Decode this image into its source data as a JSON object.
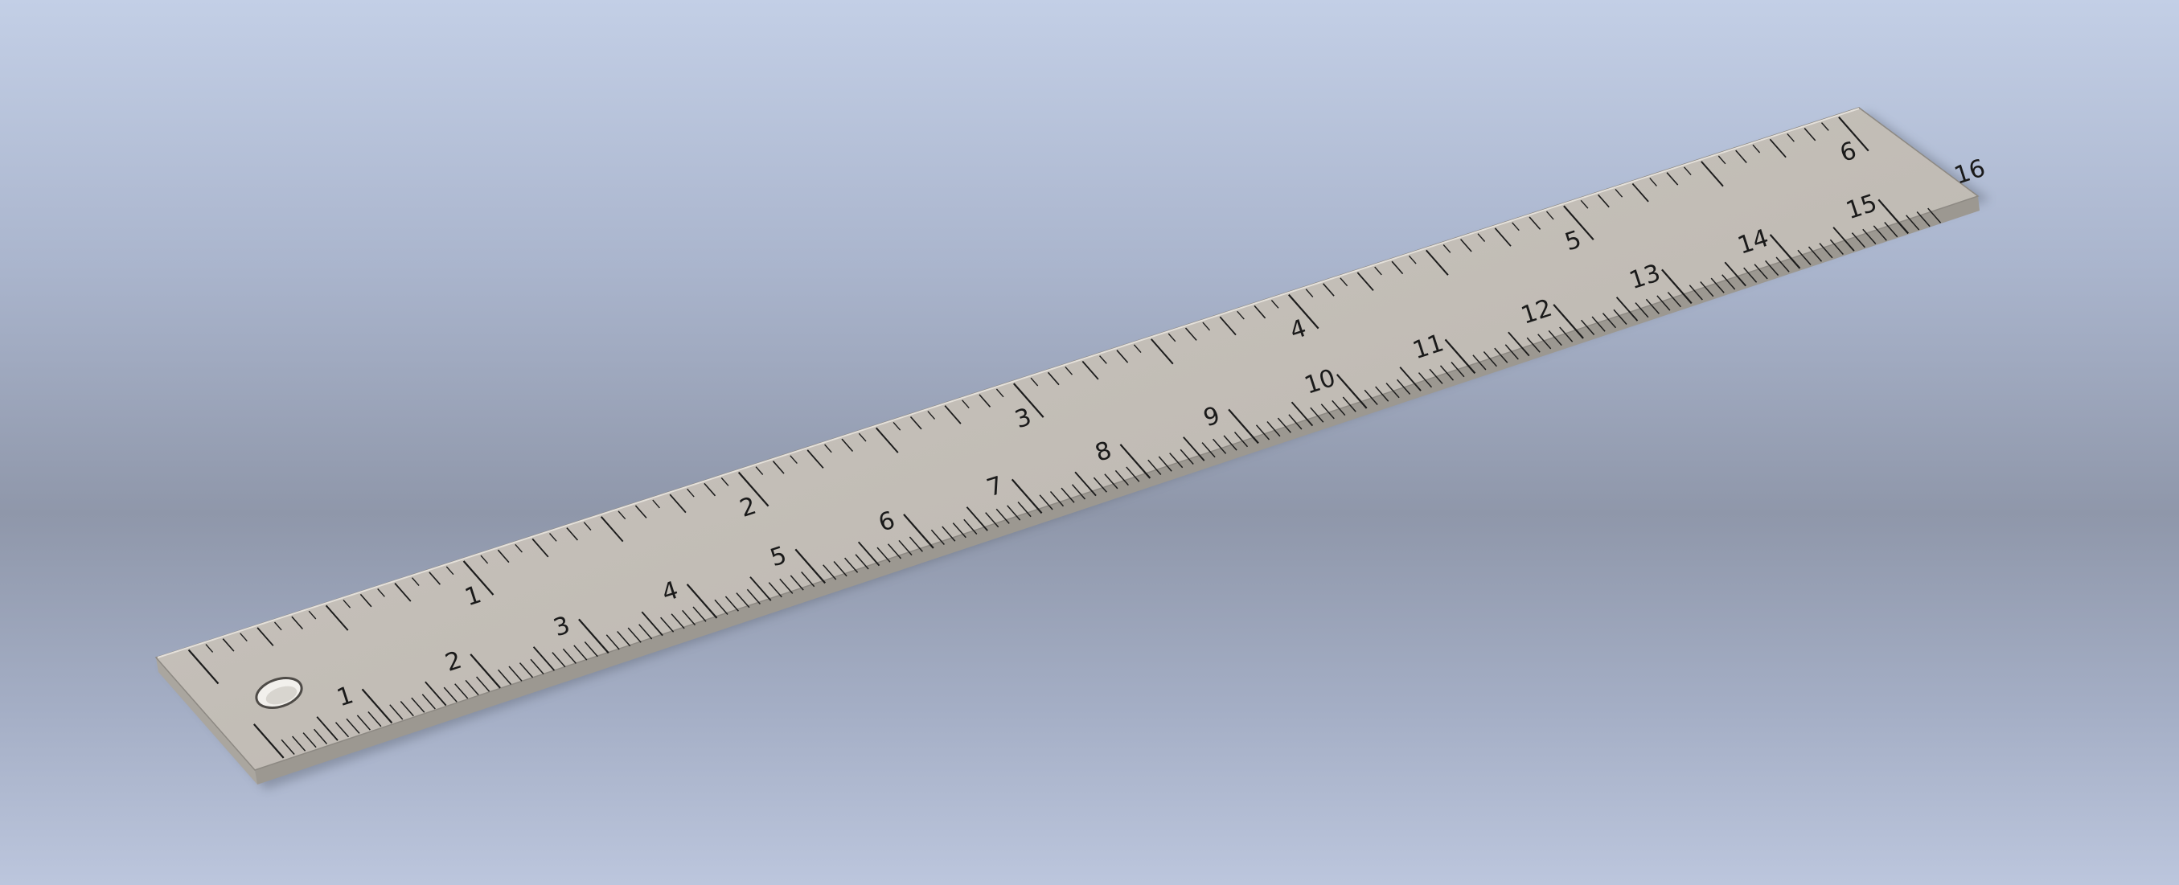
{
  "ruler": {
    "top_scale": {
      "unit": "inch",
      "labels": [
        "1",
        "2",
        "3",
        "4",
        "5",
        "6"
      ],
      "subdivisions_per_unit": 16
    },
    "bottom_scale": {
      "unit": "cm",
      "labels": [
        "1",
        "2",
        "3",
        "4",
        "5",
        "6",
        "7",
        "8",
        "9",
        "10",
        "11",
        "12",
        "13",
        "14",
        "15",
        "16"
      ],
      "subdivisions_per_unit": 10
    },
    "hanging_hole": true,
    "material_color": "#c9c4bd"
  }
}
